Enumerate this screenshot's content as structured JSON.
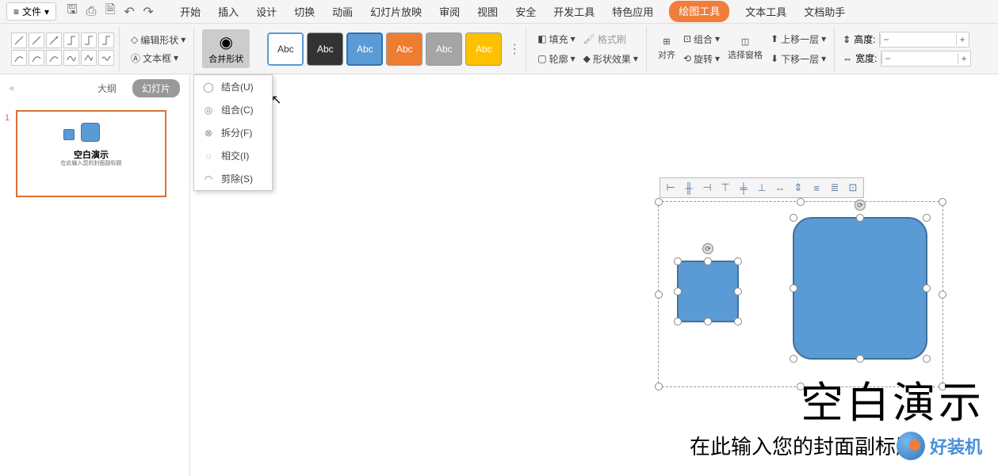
{
  "titlebar": {
    "file": "文件"
  },
  "tabs": {
    "start": "开始",
    "insert": "插入",
    "design": "设计",
    "transition": "切换",
    "animation": "动画",
    "slideshow": "幻灯片放映",
    "review": "审阅",
    "view": "视图",
    "security": "安全",
    "devtools": "开发工具",
    "featured": "特色应用",
    "drawtools": "绘图工具",
    "texttools": "文本工具",
    "dochelper": "文档助手"
  },
  "ribbon": {
    "editShape": "编辑形状",
    "textBox": "文本框",
    "merge": "合并形状",
    "swatchText": "Abc",
    "fill": "填充",
    "formatPainter": "格式刷",
    "outline": "轮廓",
    "shapeEffect": "形状效果",
    "align": "对齐",
    "rotate": "旋转",
    "selectPane": "选择窗格",
    "group": "组合",
    "moveUp": "上移一层",
    "moveDown": "下移一层",
    "height": "高度:",
    "width": "宽度:"
  },
  "dropdown": {
    "union": "结合(U)",
    "combine": "组合(C)",
    "fragment": "拆分(F)",
    "intersect": "相交(I)",
    "subtract": "剪除(S)"
  },
  "side": {
    "outline": "大纲",
    "slides": "幻灯片",
    "collapse": "«"
  },
  "thumb": {
    "num": "1",
    "title": "空白演示",
    "sub": "在此输入您的封面副标题"
  },
  "slide": {
    "title": "空白演示",
    "sub": "在此输入您的封面副标题"
  },
  "watermark": {
    "text": "好装机"
  }
}
